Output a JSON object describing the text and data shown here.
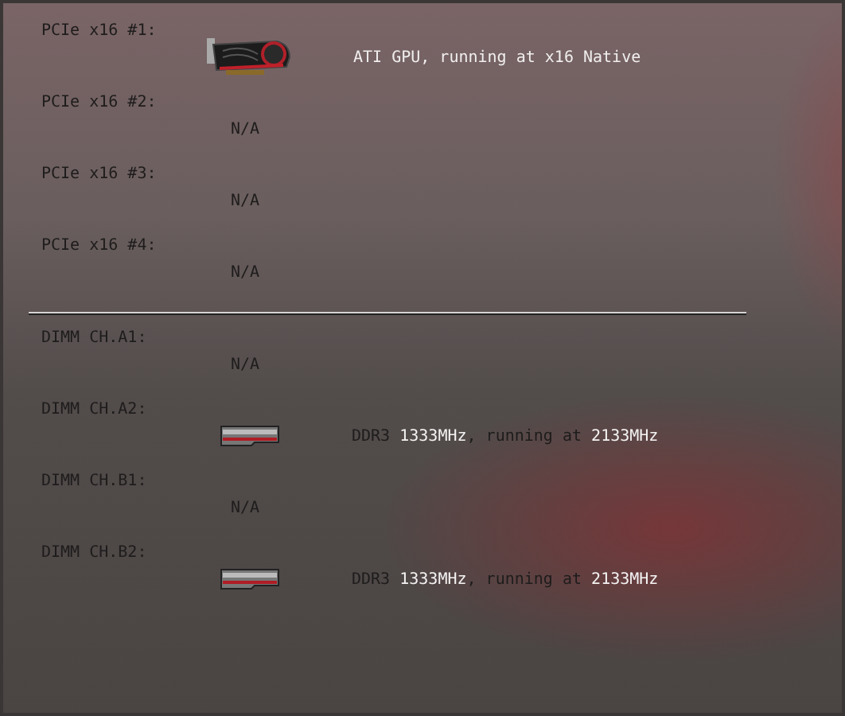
{
  "sections": [
    {
      "slots": [
        {
          "label": "PCIe x16 #1:",
          "kind": "gpu",
          "detail": "ATI GPU, running at x16 Native"
        },
        {
          "label": "PCIe x16 #2:",
          "kind": "empty",
          "detail": "N/A"
        },
        {
          "label": "PCIe x16 #3:",
          "kind": "empty",
          "detail": "N/A"
        },
        {
          "label": "PCIe x16 #4:",
          "kind": "empty",
          "detail": "N/A"
        }
      ]
    },
    {
      "slots": [
        {
          "label": "DIMM CH.A1:",
          "kind": "empty",
          "detail": "N/A"
        },
        {
          "label": "DIMM CH.A2:",
          "kind": "dimm",
          "detail": "DDR3 **1333MHz**, running at **2133MHz**"
        },
        {
          "label": "DIMM CH.B1:",
          "kind": "empty",
          "detail": "N/A"
        },
        {
          "label": "DIMM CH.B2:",
          "kind": "dimm",
          "detail": "DDR3 **1333MHz**, running at **2133MHz**"
        }
      ]
    }
  ]
}
